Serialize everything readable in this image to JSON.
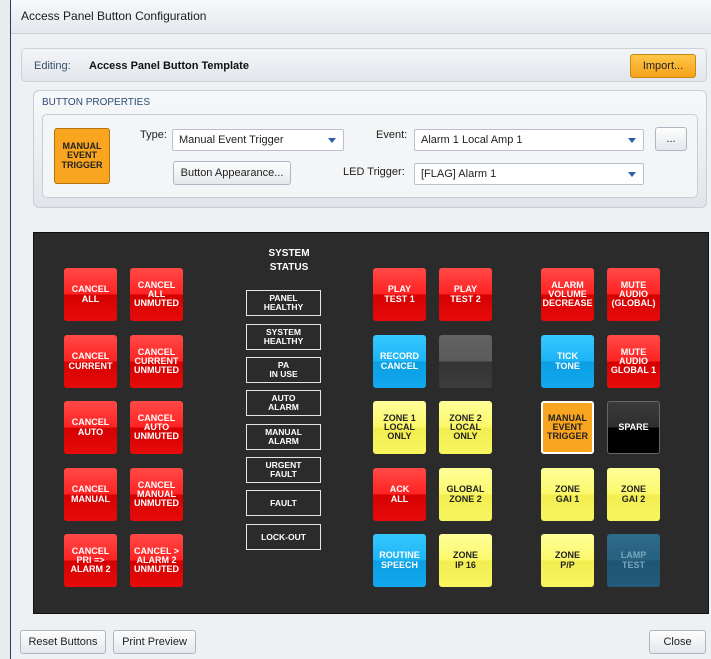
{
  "window": {
    "title": "Access Panel Button Configuration"
  },
  "editing": {
    "label": "Editing:",
    "name": "Access Panel Button Template",
    "import_label": "Import..."
  },
  "properties": {
    "header": "BUTTON PROPERTIES",
    "preview": "MANUAL\nEVENT\nTRIGGER",
    "type_label": "Type:",
    "type_value": "Manual Event Trigger",
    "event_label": "Event:",
    "event_value": "Alarm 1 Local Amp 1",
    "more_label": "...",
    "appearance_label": "Button Appearance...",
    "led_label": "LED Trigger:",
    "led_value": "[FLAG] Alarm 1"
  },
  "status": {
    "title": "SYSTEM\nSTATUS",
    "items": [
      "PANEL\nHEALTHY",
      "SYSTEM\nHEALTHY",
      "PA\nIN USE",
      "AUTO\nALARM",
      "MANUAL\nALARM",
      "URGENT\nFAULT",
      "FAULT",
      "LOCK-OUT"
    ]
  },
  "buttons": {
    "left": [
      "CANCEL\nALL",
      "CANCEL\nALL\nUNMUTED",
      "CANCEL\nCURRENT",
      "CANCEL\nCURRENT\nUNMUTED",
      "CANCEL\nAUTO",
      "CANCEL\nAUTO\nUNMUTED",
      "CANCEL\nMANUAL",
      "CANCEL\nMANUAL\nUNMUTED",
      "CANCEL\nPRI =>\nALARM 2",
      "CANCEL >\nALARM 2\nUNMUTED"
    ],
    "mid": [
      "PLAY\nTEST 1",
      "PLAY\nTEST 2",
      "RECORD\nCANCEL",
      "",
      "ZONE 1\nLOCAL\nONLY",
      "ZONE 2\nLOCAL\nONLY",
      "ACK\nALL",
      "GLOBAL\nZONE 2",
      "ROUTINE\nSPEECH",
      "ZONE\nIP 16"
    ],
    "right": [
      "ALARM\nVOLUME\nDECREASE",
      "MUTE\nAUDIO\n(GLOBAL)",
      "TICK\nTONE",
      "MUTE\nAUDIO\nGLOBAL 1",
      "MANUAL\nEVENT\nTRIGGER",
      "SPARE",
      "ZONE\nGAI 1",
      "ZONE\nGAI 2",
      "ZONE\nP/P",
      "LAMP\nTEST"
    ]
  },
  "footer": {
    "reset_label": "Reset Buttons",
    "print_label": "Print Preview",
    "close_label": "Close"
  },
  "colors": {
    "red": "#ee1111",
    "blue": "#1aaef0",
    "yellow": "#f8f560",
    "orange": "#f9a51f",
    "black": "#000000",
    "panel": "#2b2b2b"
  }
}
